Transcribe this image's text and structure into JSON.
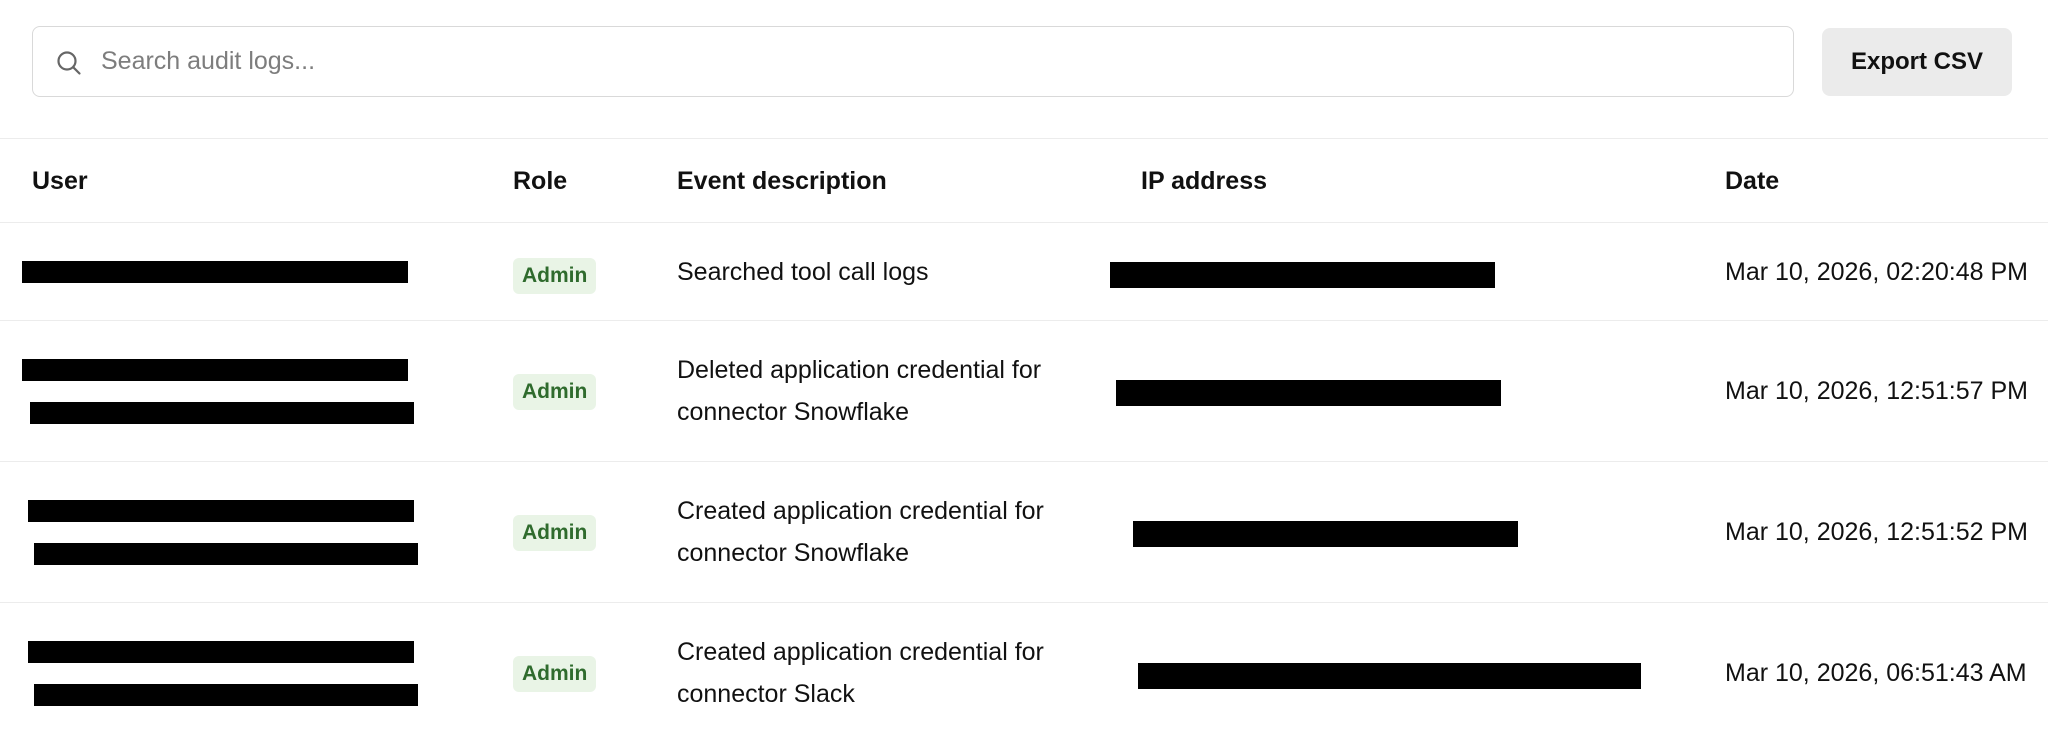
{
  "search": {
    "placeholder": "Search audit logs...",
    "value": ""
  },
  "toolbar": {
    "export_label": "Export CSV"
  },
  "table": {
    "columns": {
      "user": "User",
      "role": "Role",
      "event": "Event description",
      "ip": "IP address",
      "date": "Date"
    },
    "rows": [
      {
        "user": "[redacted]",
        "role": "Admin",
        "event": "Searched tool call logs",
        "ip": "[redacted]",
        "date": "Mar 10, 2026, 02:20:48 PM"
      },
      {
        "user": "[redacted]",
        "role": "Admin",
        "event": "Deleted application credential for connector Snowflake",
        "ip": "[redacted]",
        "date": "Mar 10, 2026, 12:51:57 PM"
      },
      {
        "user": "[redacted]",
        "role": "Admin",
        "event": "Created application credential for connector Snowflake",
        "ip": "[redacted]",
        "date": "Mar 10, 2026, 12:51:52 PM"
      },
      {
        "user": "[redacted]",
        "role": "Admin",
        "event": "Created application credential for connector Slack",
        "ip": "[redacted]",
        "date": "Mar 10, 2026, 06:51:43 AM"
      }
    ]
  },
  "colors": {
    "badge_bg": "#e9f4e6",
    "badge_text": "#2f6b2d",
    "button_bg": "#ebebeb",
    "border": "#ececec"
  },
  "icons": {
    "search": "search-icon"
  }
}
